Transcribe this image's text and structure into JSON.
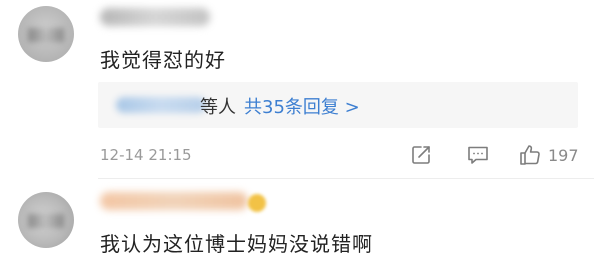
{
  "comments": [
    {
      "text": "我觉得怼的好",
      "reply_summary": {
        "suffix": "等人",
        "count_text": "共35条回复 >"
      },
      "timestamp": "12-14 21:15",
      "actions": {
        "share_icon": "share-box-arrow-icon",
        "reply_icon": "comment-bubble-icon",
        "like_icon": "thumbs-up-icon",
        "like_count": "197"
      }
    },
    {
      "text": "我认为这位博士妈妈没说错啊"
    }
  ],
  "colors": {
    "text": "#222222",
    "link": "#3d7fd1",
    "meta": "#9a9a9a",
    "reply_bg": "#f6f6f6"
  }
}
